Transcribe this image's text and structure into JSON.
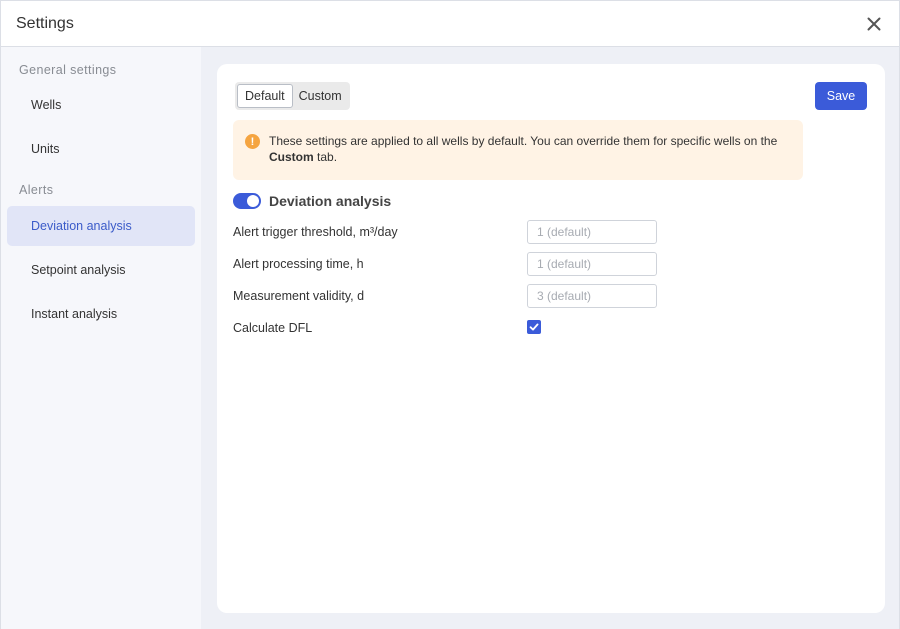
{
  "header": {
    "title": "Settings"
  },
  "sidebar": {
    "sections": [
      {
        "label": "General settings",
        "items": [
          "Wells",
          "Units"
        ]
      },
      {
        "label": "Alerts",
        "items": [
          "Deviation analysis",
          "Setpoint analysis",
          "Instant analysis"
        ]
      }
    ],
    "active_item": "Deviation analysis"
  },
  "tabs": {
    "default_label": "Default",
    "custom_label": "Custom",
    "active": "Default"
  },
  "toolbar": {
    "save_label": "Save"
  },
  "notice": {
    "icon": "exclamation-icon",
    "text_before": "These settings are applied to all wells by default. You can override them for specific wells on the ",
    "text_bold": "Custom",
    "text_after": " tab."
  },
  "section": {
    "title": "Deviation analysis",
    "enabled": true
  },
  "fields": {
    "threshold": {
      "label": "Alert trigger threshold, m³/day",
      "placeholder": "1 (default)",
      "value": ""
    },
    "processing_time": {
      "label": "Alert processing time, h",
      "placeholder": "1 (default)",
      "value": ""
    },
    "validity": {
      "label": "Measurement validity, d",
      "placeholder": "3 (default)",
      "value": ""
    },
    "calculate_dfl": {
      "label": "Calculate DFL",
      "checked": true
    }
  },
  "colors": {
    "accent": "#3b5bd9",
    "notice_bg": "#fff3e5",
    "notice_icon": "#f5a440",
    "active_nav_bg": "#e1e5f7"
  }
}
